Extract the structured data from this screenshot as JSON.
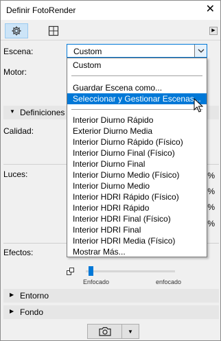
{
  "window": {
    "title": "Definir FotoRender"
  },
  "toolbar": {
    "tabs": [
      {
        "icon": "gear-icon"
      },
      {
        "icon": "layout-grid-icon"
      }
    ]
  },
  "labels": {
    "escena": "Escena:",
    "motor": "Motor:",
    "calidad": "Calidad:",
    "luces": "Luces:",
    "efectos": "Efectos:"
  },
  "sections": {
    "definiciones": "Definiciones",
    "entorno": "Entorno",
    "fondo": "Fondo"
  },
  "scene_combo": {
    "value": "Custom"
  },
  "dropdown": {
    "top_item": "Custom",
    "action_items": [
      "Guardar Escena como...",
      "Seleccionar y Gestionar Escenas..."
    ],
    "highlighted_index": 1,
    "presets": [
      "Interior Diurno Rápido",
      "Exterior Diurno Media",
      "Interior Diurno Rápido (Físico)",
      "Interior Diurno Final (Físico)",
      "Interior Diurno Final",
      "Interior Diurno Medio (Físico)",
      "Interior Diurno Medio",
      "Interior HDRI Rápido (Físico)",
      "Interior HDRI Rápido",
      "Interior HDRI Final (Físico)",
      "Interior HDRI Final",
      "Interior HDRI Media (Físico)",
      "Mostrar Más..."
    ]
  },
  "percent_marks": [
    "%",
    "%",
    "%",
    "%"
  ],
  "slider": {
    "left_caption": "Enfocado",
    "right_caption": "enfocado",
    "level": 0.03
  },
  "colors": {
    "accent": "#0078d7",
    "highlight": "#0078d7",
    "tab_active": "#cce4f7"
  }
}
